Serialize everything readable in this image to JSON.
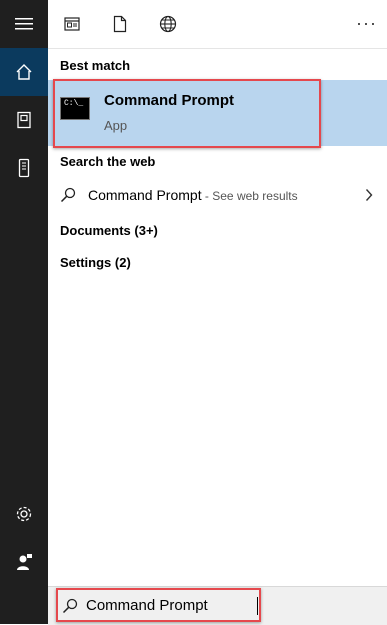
{
  "rail": {
    "items": [
      {
        "icon": "home-icon"
      },
      {
        "icon": "documents-icon"
      },
      {
        "icon": "device-icon"
      }
    ],
    "bottom": [
      {
        "icon": "settings-gear-icon"
      },
      {
        "icon": "user-feedback-icon"
      }
    ]
  },
  "topbar": {
    "filters": [
      {
        "icon": "apps-filter-icon"
      },
      {
        "icon": "document-filter-icon"
      },
      {
        "icon": "web-globe-icon"
      }
    ],
    "more": "···"
  },
  "results": {
    "best_match_heading": "Best match",
    "best_match": {
      "title": "Command Prompt",
      "subtitle": "App",
      "icon_text": "C:\\_"
    },
    "web_heading": "Search the web",
    "web_result": {
      "label": "Command Prompt",
      "suffix": " - See web results"
    },
    "documents": "Documents (3+)",
    "settings": "Settings (2)"
  },
  "search": {
    "value": "Command Prompt",
    "placeholder": ""
  },
  "colors": {
    "rail": "#1f1f1f",
    "rail_active": "#0b3a5e",
    "best_match_bg": "#b9d5ee",
    "highlight_border": "#e5484d"
  }
}
